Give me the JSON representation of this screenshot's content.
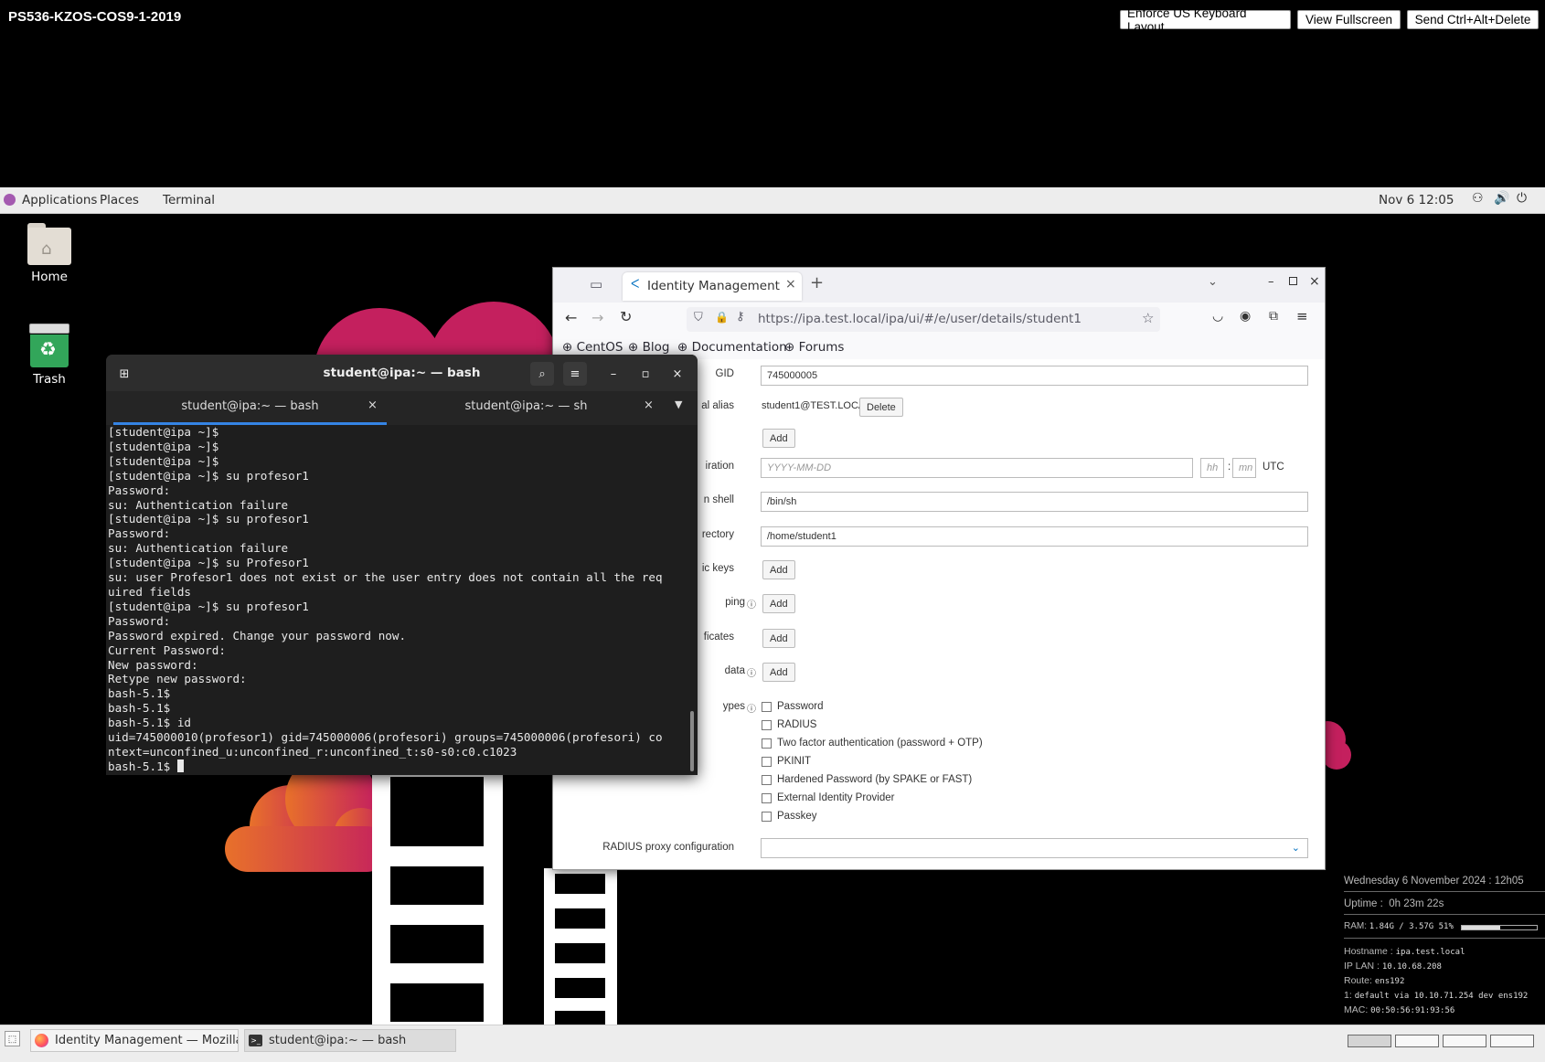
{
  "vnc": {
    "title": "PS536-KZOS-COS9-1-2019",
    "buttons": [
      "Enforce US Keyboard Layout",
      "View Fullscreen",
      "Send Ctrl+Alt+Delete"
    ]
  },
  "topbar": {
    "applications": "Applications",
    "places": "Places",
    "terminal": "Terminal",
    "datetime": "Nov 6  12:05"
  },
  "desktop": {
    "home_label": "Home",
    "trash_label": "Trash"
  },
  "firefox": {
    "tab_title": "Identity Management",
    "url": "https://ipa.test.local/ipa/ui/#/e/user/details/student1",
    "bookmarks": [
      "CentOS",
      "Blog",
      "Documentation",
      "Forums"
    ],
    "form": {
      "gid_label": "GID",
      "gid_value": "745000005",
      "alias_label": "al alias",
      "alias_value": "student1@TEST.LOCAL",
      "delete_label": "Delete",
      "add_label": "Add",
      "expiration_label": "iration",
      "date_placeholder": "YYYY-MM-DD",
      "hh_placeholder": "hh",
      "mn_placeholder": "mn",
      "utc": "UTC",
      "shell_label": "n shell",
      "shell_value": "/bin/sh",
      "directory_label": "rectory",
      "directory_value": "/home/student1",
      "keys_label": "ic keys",
      "mapping_label": "ping",
      "certificates_label": "ficates",
      "data_label": "data",
      "types_label": "ypes",
      "auth_types": [
        "Password",
        "RADIUS",
        "Two factor authentication (password + OTP)",
        "PKINIT",
        "Hardened Password (by SPAKE or FAST)",
        "External Identity Provider",
        "Passkey"
      ],
      "radius_label": "RADIUS proxy configuration"
    }
  },
  "terminal": {
    "title": "student@ipa:~ — bash",
    "tabs": [
      "student@ipa:~ — bash",
      "student@ipa:~ — sh"
    ],
    "lines": [
      "[student@ipa ~]$",
      "[student@ipa ~]$",
      "[student@ipa ~]$",
      "[student@ipa ~]$ su profesor1",
      "Password:",
      "su: Authentication failure",
      "[student@ipa ~]$ su profesor1",
      "Password:",
      "su: Authentication failure",
      "[student@ipa ~]$ su Profesor1",
      "su: user Profesor1 does not exist or the user entry does not contain all the req",
      "uired fields",
      "[student@ipa ~]$ su profesor1",
      "Password:",
      "Password expired. Change your password now.",
      "Current Password:",
      "New password:",
      "Retype new password:",
      "bash-5.1$",
      "bash-5.1$",
      "bash-5.1$ id",
      "uid=745000010(profesor1) gid=745000006(profesori) groups=745000006(profesori) co",
      "ntext=unconfined_u:unconfined_r:unconfined_t:s0-s0:c0.c1023",
      "bash-5.1$ "
    ]
  },
  "conky": {
    "date": "Wednesday  6 November 2024 : 12h05",
    "uptime_label": "Uptime :",
    "uptime_value": "0h 23m 22s",
    "ram_label": "RAM:",
    "ram_value": "1.84G / 3.57G 51%",
    "ram_fraction": 0.51,
    "hostname_label": "Hostname :",
    "hostname_value": "ipa.test.local",
    "iplan_label": "IP LAN :",
    "iplan_value": "10.10.68.208",
    "route_label": "Route:",
    "route_value": "ens192",
    "route1_label": "1:",
    "route1_value": "default via 10.10.71.254 dev ens192",
    "mac_label": "MAC:",
    "mac_value": "00:50:56:91:93:56"
  },
  "taskbar": {
    "tasks": [
      "Identity Management — Mozilla Fi...",
      "student@ipa:~ — bash"
    ]
  },
  "colors": {
    "cloud_magenta": "#c4205e",
    "cloud_orange": "#e8712a",
    "terminal_bg": "#1e1e1e"
  }
}
